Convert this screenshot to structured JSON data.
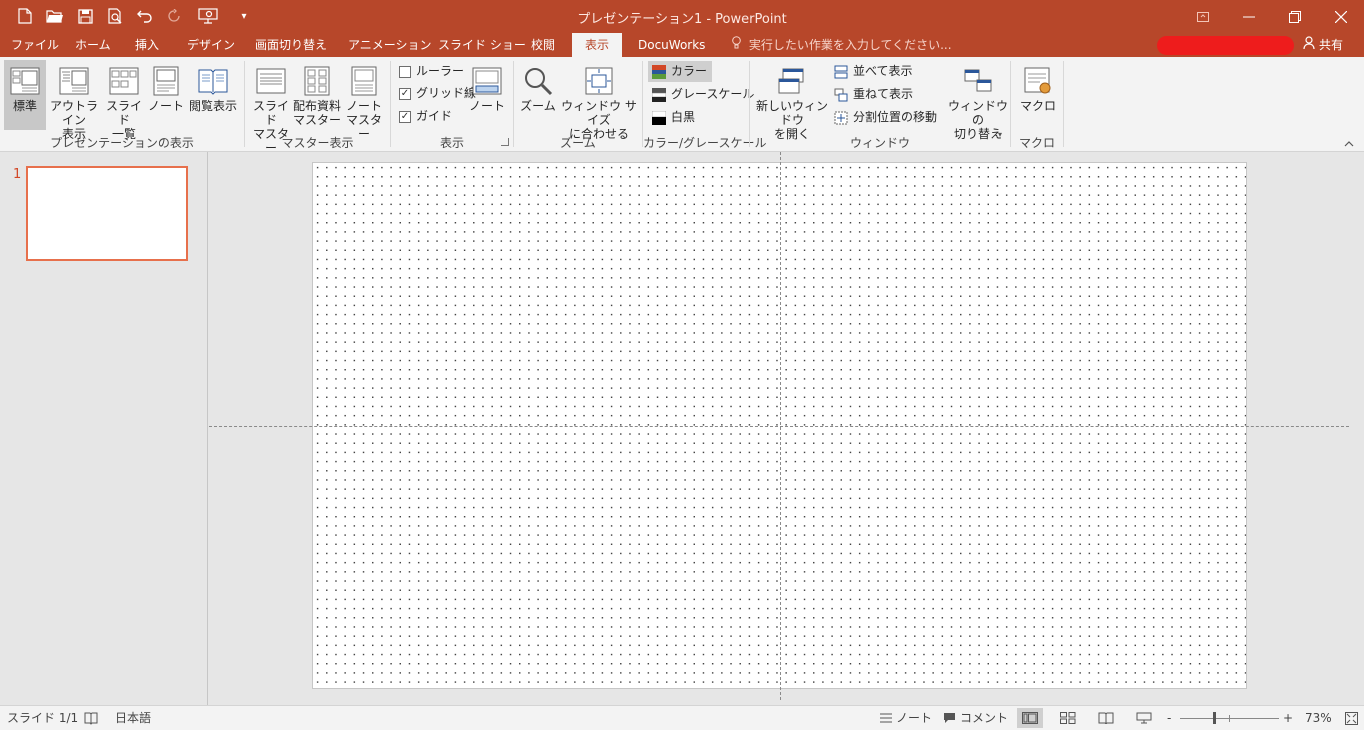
{
  "window": {
    "title": "プレゼンテーション1 - PowerPoint",
    "accent": "#b7472a"
  },
  "quick_access": [
    {
      "name": "new-file-icon"
    },
    {
      "name": "open-folder-icon"
    },
    {
      "name": "save-icon"
    },
    {
      "name": "print-preview-icon"
    },
    {
      "name": "undo-icon"
    },
    {
      "name": "redo-icon"
    },
    {
      "name": "presentation-start-icon"
    },
    {
      "name": "customize-qat-icon"
    }
  ],
  "tabs": [
    {
      "label": "ファイル"
    },
    {
      "label": "ホーム"
    },
    {
      "label": "挿入"
    },
    {
      "label": "デザイン"
    },
    {
      "label": "画面切り替え"
    },
    {
      "label": "アニメーション"
    },
    {
      "label": "スライド ショー"
    },
    {
      "label": "校閲"
    },
    {
      "label": "表示",
      "active": true
    },
    {
      "label": "DocuWorks"
    }
  ],
  "tell_me": "実行したい作業を入力してください...",
  "share": "共有",
  "ribbon": {
    "presentation_views": {
      "label": "プレゼンテーションの表示",
      "normal": "標準",
      "outline": "アウトライン\n表示",
      "slide_sorter": "スライド\n一覧",
      "notes_page": "ノート",
      "reading_view": "閲覧表示"
    },
    "master_views": {
      "label": "マスター表示",
      "slide_master": "スライド\nマスター",
      "handout_master": "配布資料\nマスター",
      "notes_master": "ノート\nマスター"
    },
    "show": {
      "label": "表示",
      "ruler": "ルーラー",
      "ruler_checked": false,
      "gridlines": "グリッド線",
      "gridlines_checked": true,
      "guides": "ガイド",
      "guides_checked": true,
      "notes": "ノート"
    },
    "zoom": {
      "label": "ズーム",
      "zoom": "ズーム",
      "fit": "ウィンドウ サイズ\nに合わせる"
    },
    "color": {
      "label": "カラー/グレースケール",
      "color": "カラー",
      "grayscale": "グレースケール",
      "bw": "白黒"
    },
    "window": {
      "label": "ウィンドウ",
      "new_window": "新しいウィンドウ\nを開く",
      "arrange_all": "並べて表示",
      "cascade": "重ねて表示",
      "move_split": "分割位置の移動",
      "switch_windows": "ウィンドウの\n切り替え"
    },
    "macros": {
      "label": "マクロ",
      "macros": "マクロ"
    }
  },
  "slides": [
    {
      "number": "1",
      "selected": true
    }
  ],
  "status": {
    "slide": "スライド 1/1",
    "language": "日本語",
    "notes": "ノート",
    "comments": "コメント",
    "zoom_minus": "-",
    "zoom_plus": "+",
    "zoom": "73%",
    "zoom_value": 0.73
  }
}
